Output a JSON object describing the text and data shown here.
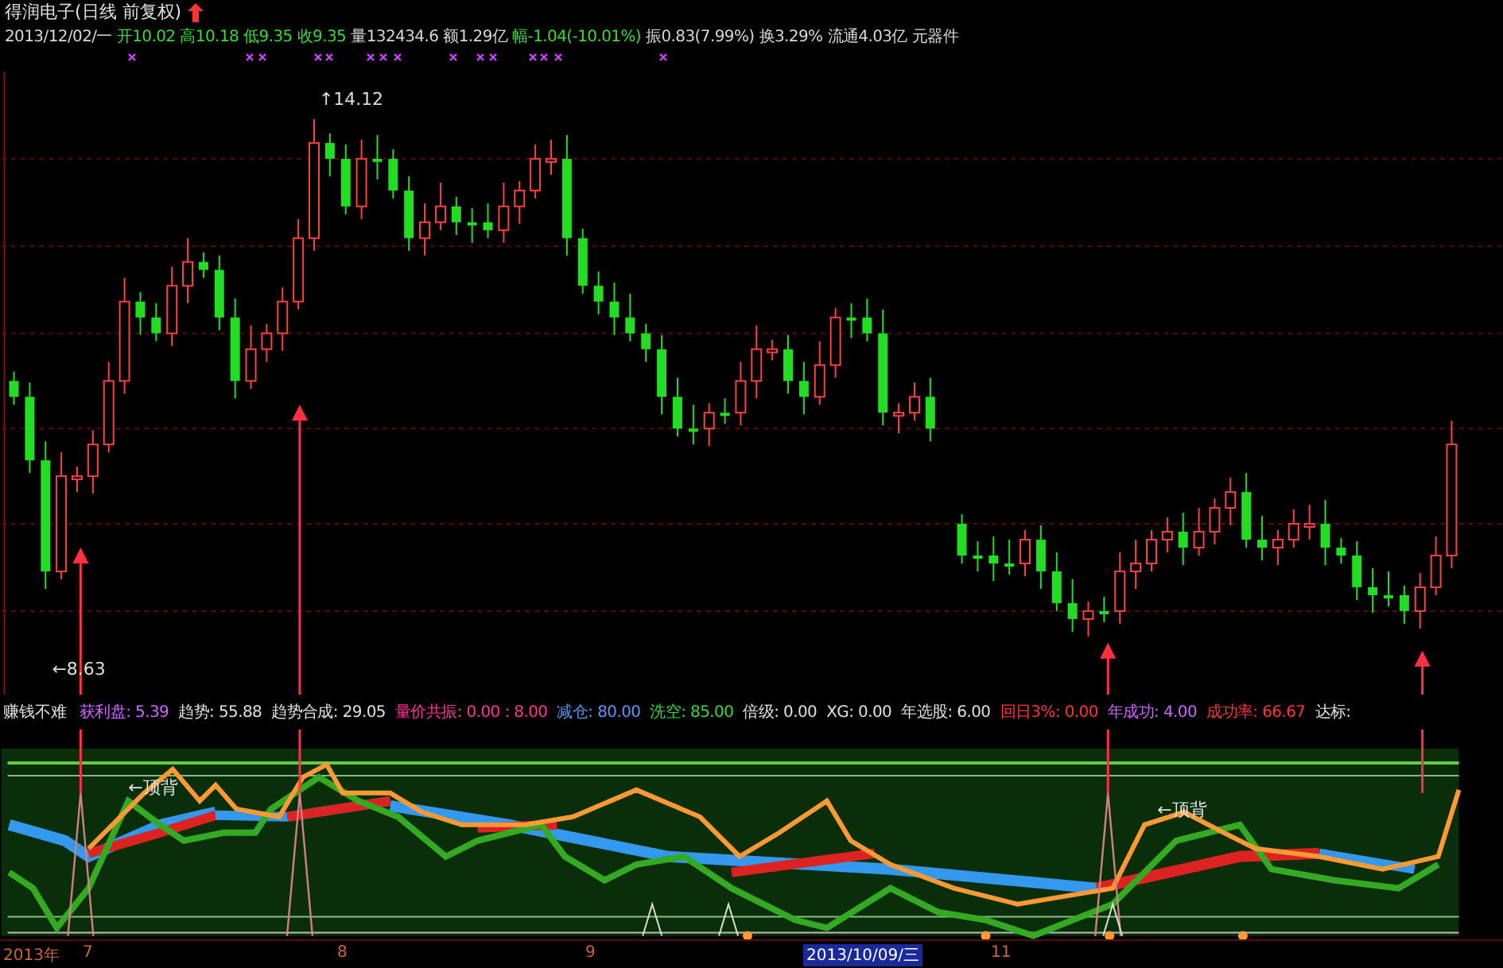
{
  "header": {
    "title": "得润电子(日线 前复权)",
    "quote": [
      {
        "label": "2013/12/02/一",
        "color": "#d8d8d8"
      },
      {
        "label": "开",
        "value": "10.02",
        "color": "#33dd33"
      },
      {
        "label": "高",
        "value": "10.18",
        "color": "#33dd33"
      },
      {
        "label": "低",
        "value": "9.35",
        "color": "#33dd33"
      },
      {
        "label": "收",
        "value": "9.35",
        "color": "#33dd33"
      },
      {
        "label": "量",
        "value": "132434.6",
        "color": "#d8d8d8"
      },
      {
        "label": "额",
        "value": "1.29亿",
        "color": "#d8d8d8"
      },
      {
        "label": "幅",
        "value": "-1.04(-10.01%)",
        "color": "#33dd33"
      },
      {
        "label": "振",
        "value": "0.83(7.99%)",
        "color": "#d8d8d8"
      },
      {
        "label": "换",
        "value": "3.29%",
        "color": "#d8d8d8"
      },
      {
        "label": "流通",
        "value": "4.03亿",
        "color": "#d8d8d8"
      },
      {
        "label": "元器件",
        "color": "#d8d8d8"
      }
    ]
  },
  "price_chart": {
    "high_label": "↑14.12",
    "low_label": "←8.63"
  },
  "indicator": {
    "title": "赚钱不难",
    "items": [
      {
        "label": "获利盘:",
        "value": "5.39",
        "color": "#cc66ff"
      },
      {
        "label": "趋势:",
        "value": "55.88",
        "color": "#e0e0e0"
      },
      {
        "label": "趋势合成:",
        "value": "29.05",
        "color": "#e0e0e0"
      },
      {
        "label": "量价共振:",
        "value": "0.00 : 8.00",
        "color": "#ff3399"
      },
      {
        "label": "减仓:",
        "value": "80.00",
        "color": "#5599ff"
      },
      {
        "label": "洗空:",
        "value": "85.00",
        "color": "#33dd33"
      },
      {
        "label": "倍级:",
        "value": "0.00",
        "color": "#e0e0e0"
      },
      {
        "label": "XG:",
        "value": "0.00",
        "color": "#e0e0e0"
      },
      {
        "label": "年选股:",
        "value": "6.00",
        "color": "#e0e0e0"
      },
      {
        "label": "回日3%:",
        "value": "0.00",
        "color": "#ff3333"
      },
      {
        "label": "年成功:",
        "value": "4.00",
        "color": "#cc66ff"
      },
      {
        "label": "成功率:",
        "value": "66.67",
        "color": "#ff3333"
      },
      {
        "label": "达标:",
        "color": "#e0e0e0"
      }
    ],
    "labels": [
      "←顶背",
      "←顶背"
    ]
  },
  "time_axis": {
    "labels": [
      {
        "label": "2013年",
        "selected": false
      },
      {
        "label": "7",
        "selected": false
      },
      {
        "label": "8",
        "selected": false
      },
      {
        "label": "9",
        "selected": false
      },
      {
        "label": "2013/10/09/三",
        "selected": true
      },
      {
        "label": "11",
        "selected": false
      }
    ]
  }
}
